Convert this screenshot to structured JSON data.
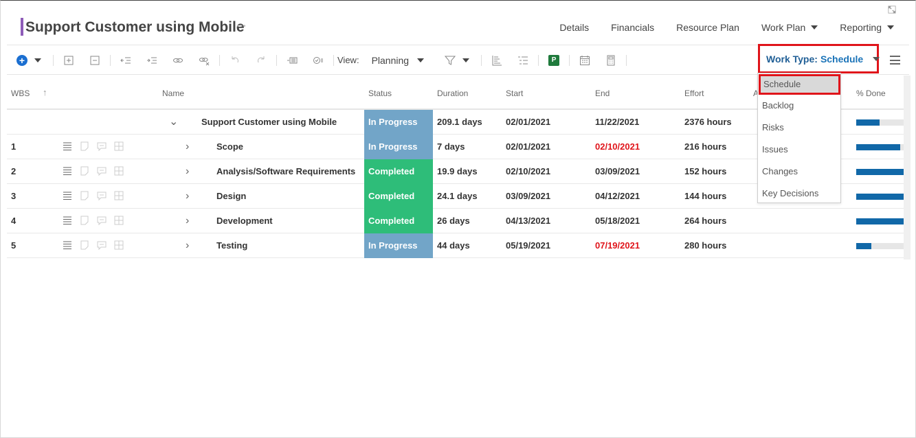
{
  "header": {
    "project_title": "Support Customer using Mobile",
    "more_label": "•••",
    "nav": [
      {
        "label": "Details"
      },
      {
        "label": "Financials"
      },
      {
        "label": "Resource Plan"
      },
      {
        "label": "Work Plan",
        "dropdown": true
      },
      {
        "label": "Reporting",
        "dropdown": true
      }
    ]
  },
  "toolbar": {
    "view_label": "View:",
    "view_value": "Planning",
    "excel_label": "P",
    "work_type_label": "Work Type:",
    "work_type_value": "Schedule"
  },
  "table": {
    "columns": {
      "wbs": "WBS",
      "name": "Name",
      "status": "Status",
      "duration": "Duration",
      "start": "Start",
      "end": "End",
      "effort": "Effort",
      "assigned": "A",
      "done": "% Done"
    },
    "rows": [
      {
        "wbs": "",
        "name": "Support Customer using Mobile",
        "status": "In Progress",
        "duration": "209.1 days",
        "start": "02/01/2021",
        "end": "11/22/2021",
        "end_late": false,
        "effort": "2376 hours",
        "done": 0.48,
        "summary": true
      },
      {
        "wbs": "1",
        "name": "Scope",
        "status": "In Progress",
        "duration": "7 days",
        "start": "02/01/2021",
        "end": "02/10/2021",
        "end_late": true,
        "effort": "216 hours",
        "done": 0.92
      },
      {
        "wbs": "2",
        "name": "Analysis/Software Requirements",
        "status": "Completed",
        "duration": "19.9 days",
        "start": "02/10/2021",
        "end": "03/09/2021",
        "end_late": false,
        "effort": "152 hours",
        "done": 1.0
      },
      {
        "wbs": "3",
        "name": "Design",
        "status": "Completed",
        "duration": "24.1 days",
        "start": "03/09/2021",
        "end": "04/12/2021",
        "end_late": false,
        "effort": "144 hours",
        "done": 1.0
      },
      {
        "wbs": "4",
        "name": "Development",
        "status": "Completed",
        "duration": "26 days",
        "start": "04/13/2021",
        "end": "05/18/2021",
        "end_late": false,
        "effort": "264 hours",
        "done": 1.0
      },
      {
        "wbs": "5",
        "name": "Testing",
        "status": "In Progress",
        "duration": "44 days",
        "start": "05/19/2021",
        "end": "07/19/2021",
        "end_late": true,
        "effort": "280 hours",
        "done": 0.32
      }
    ]
  },
  "work_type_dropdown": {
    "selected": "Schedule",
    "options": [
      "Backlog",
      "Risks",
      "Issues",
      "Changes",
      "Key Decisions"
    ]
  },
  "colors": {
    "in_progress": "#72a5c8",
    "completed": "#2ebd79",
    "late": "#e0141a",
    "highlight": "#e0141a",
    "progress_bar": "#1168a8"
  }
}
